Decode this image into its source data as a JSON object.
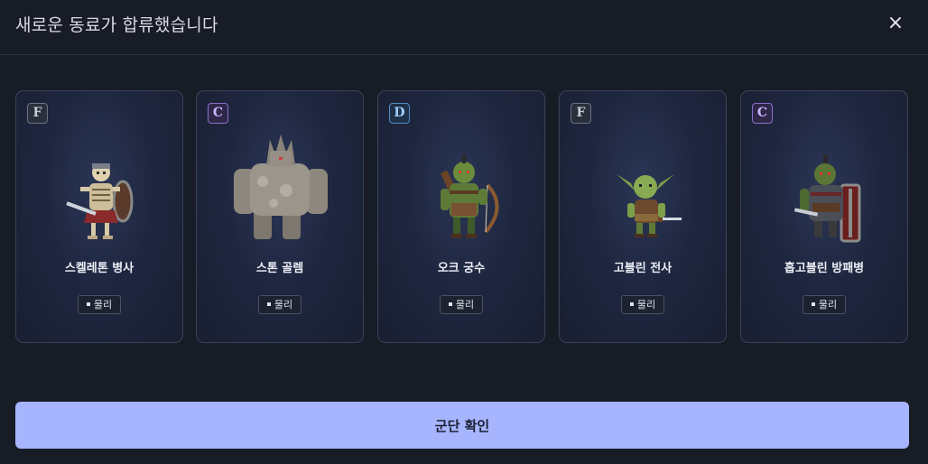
{
  "header": {
    "title": "새로운 동료가 합류했습니다",
    "close_label": "×"
  },
  "cards": [
    {
      "grade": "F",
      "name": "스켈레톤 병사",
      "tag": "물리",
      "portrait": "skeleton-soldier-icon"
    },
    {
      "grade": "C",
      "name": "스톤 골렘",
      "tag": "물리",
      "portrait": "stone-golem-icon"
    },
    {
      "grade": "D",
      "name": "오크 궁수",
      "tag": "물리",
      "portrait": "orc-archer-icon"
    },
    {
      "grade": "F",
      "name": "고블린 전사",
      "tag": "물리",
      "portrait": "goblin-warrior-icon"
    },
    {
      "grade": "C",
      "name": "홉고블린 방패병",
      "tag": "물리",
      "portrait": "hobgoblin-shieldbearer-icon"
    }
  ],
  "colors": {
    "background": "#181c27",
    "accent": "#a7b5ff",
    "grade_F": "#c9cdd6",
    "grade_C": "#c7b6ff",
    "grade_D": "#9fd0ff"
  },
  "footer": {
    "confirm_label": "군단 확인"
  }
}
